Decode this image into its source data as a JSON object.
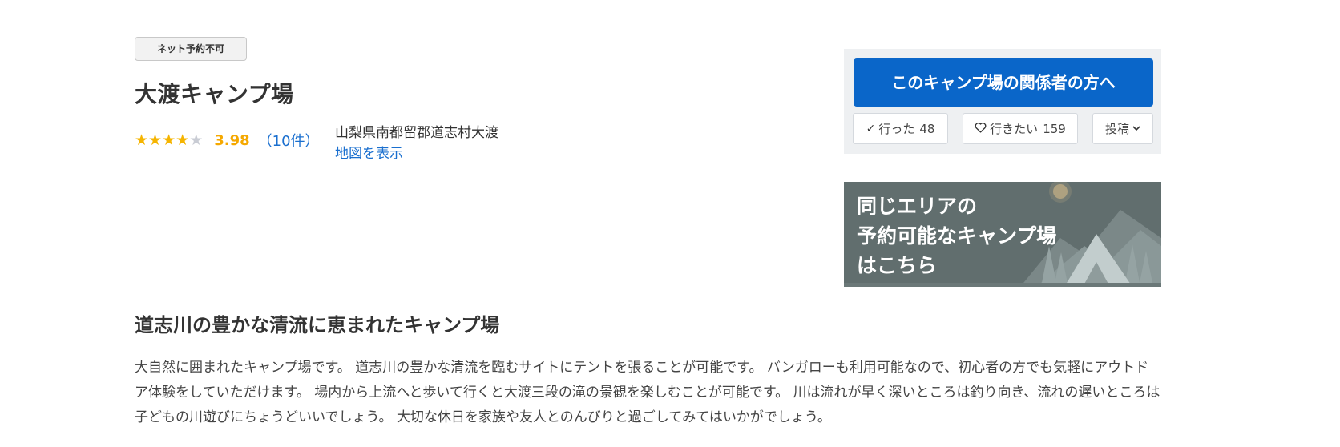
{
  "badge": "ネット予約不可",
  "title": "大渡キャンプ場",
  "rating": {
    "stars_filled": 4,
    "stars_total": 5,
    "score": "3.98",
    "count": "（10件）"
  },
  "address": "山梨県南都留郡道志村大渡",
  "map_link": "地図を表示",
  "side": {
    "owner_button": "このキャンプ場の関係者の方へ",
    "went_label": "行った",
    "went_count": "48",
    "want_label": "行きたい",
    "want_count": "159",
    "post_label": "投稿",
    "icons": {
      "went": "check-icon",
      "want": "heart-icon",
      "post": "chevron-down-icon"
    },
    "colors": {
      "primary": "#0a66c9",
      "panel_bg": "#eef0f2"
    }
  },
  "banner": {
    "line1": "同じエリアの",
    "line2": "予約可能なキャンプ場",
    "line3": "はこちら"
  },
  "section_heading": "道志川の豊かな清流に恵まれたキャンプ場",
  "description": "大自然に囲まれたキャンプ場です。 道志川の豊かな清流を臨むサイトにテントを張ることが可能です。 バンガローも利用可能なので、初心者の方でも気軽にアウトドア体験をしていただけます。 場内から上流へと歩いて行くと大渡三段の滝の景観を楽しむことが可能です。 川は流れが早く深いところは釣り向き、流れの遅いところは子どもの川遊びにちょうどいいでしょう。 大切な休日を家族や友人とのんびりと過ごしてみてはいかがでしょう。"
}
